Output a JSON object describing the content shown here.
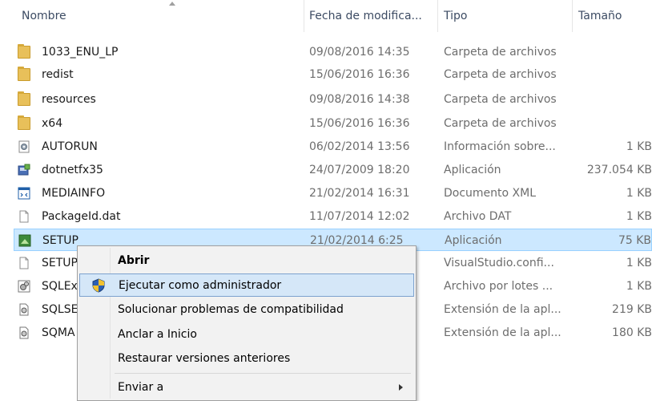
{
  "columns": {
    "name": "Nombre",
    "date": "Fecha de modifica...",
    "type": "Tipo",
    "size": "Tamaño"
  },
  "files": [
    {
      "name": "1033_ENU_LP",
      "date": "09/08/2016 14:35",
      "type": "Carpeta de archivos",
      "size": "",
      "icon": "folder-icon"
    },
    {
      "name": "redist",
      "date": "15/06/2016 16:36",
      "type": "Carpeta de archivos",
      "size": "",
      "icon": "folder-icon"
    },
    {
      "name": "resources",
      "date": "09/08/2016 14:38",
      "type": "Carpeta de archivos",
      "size": "",
      "icon": "folder-icon"
    },
    {
      "name": "x64",
      "date": "15/06/2016 16:36",
      "type": "Carpeta de archivos",
      "size": "",
      "icon": "folder-icon"
    },
    {
      "name": "AUTORUN",
      "date": "06/02/2014 13:56",
      "type": "Información sobre...",
      "size": "1 KB",
      "icon": "settings-file-icon"
    },
    {
      "name": "dotnetfx35",
      "date": "24/07/2009 18:20",
      "type": "Aplicación",
      "size": "237.054 KB",
      "icon": "installer-icon"
    },
    {
      "name": "MEDIAINFO",
      "date": "21/02/2014 16:31",
      "type": "Documento XML",
      "size": "1 KB",
      "icon": "xml-file-icon"
    },
    {
      "name": "PackageId.dat",
      "date": "11/07/2014 12:02",
      "type": "Archivo DAT",
      "size": "1 KB",
      "icon": "generic-file-icon"
    },
    {
      "name": "SETUP",
      "date": "21/02/2014 6:25",
      "type": "Aplicación",
      "size": "75 KB",
      "icon": "setup-app-icon"
    },
    {
      "name": "SETUP",
      "date": "",
      "type": "VisualStudio.confi...",
      "size": "1 KB",
      "icon": "generic-file-icon"
    },
    {
      "name": "SQLEx",
      "date": "",
      "type": "Archivo por lotes ...",
      "size": "1 KB",
      "icon": "batch-file-icon"
    },
    {
      "name": "SQLSE",
      "date": "",
      "type": "Extensión de la apl...",
      "size": "219 KB",
      "icon": "dll-file-icon"
    },
    {
      "name": "SQMA",
      "date": "",
      "type": "Extensión de la apl...",
      "size": "180 KB",
      "icon": "dll-file-icon"
    }
  ],
  "context_menu": {
    "open": "Abrir",
    "run_as_admin": "Ejecutar como administrador",
    "troubleshoot": "Solucionar problemas de compatibilidad",
    "pin_start": "Anclar a Inicio",
    "restore_versions": "Restaurar versiones anteriores",
    "send_to": "Enviar a"
  },
  "colors": {
    "selection_bg": "#cce8ff",
    "menu_highlight": "#d5e7f8",
    "header_text": "#3c4b63"
  }
}
